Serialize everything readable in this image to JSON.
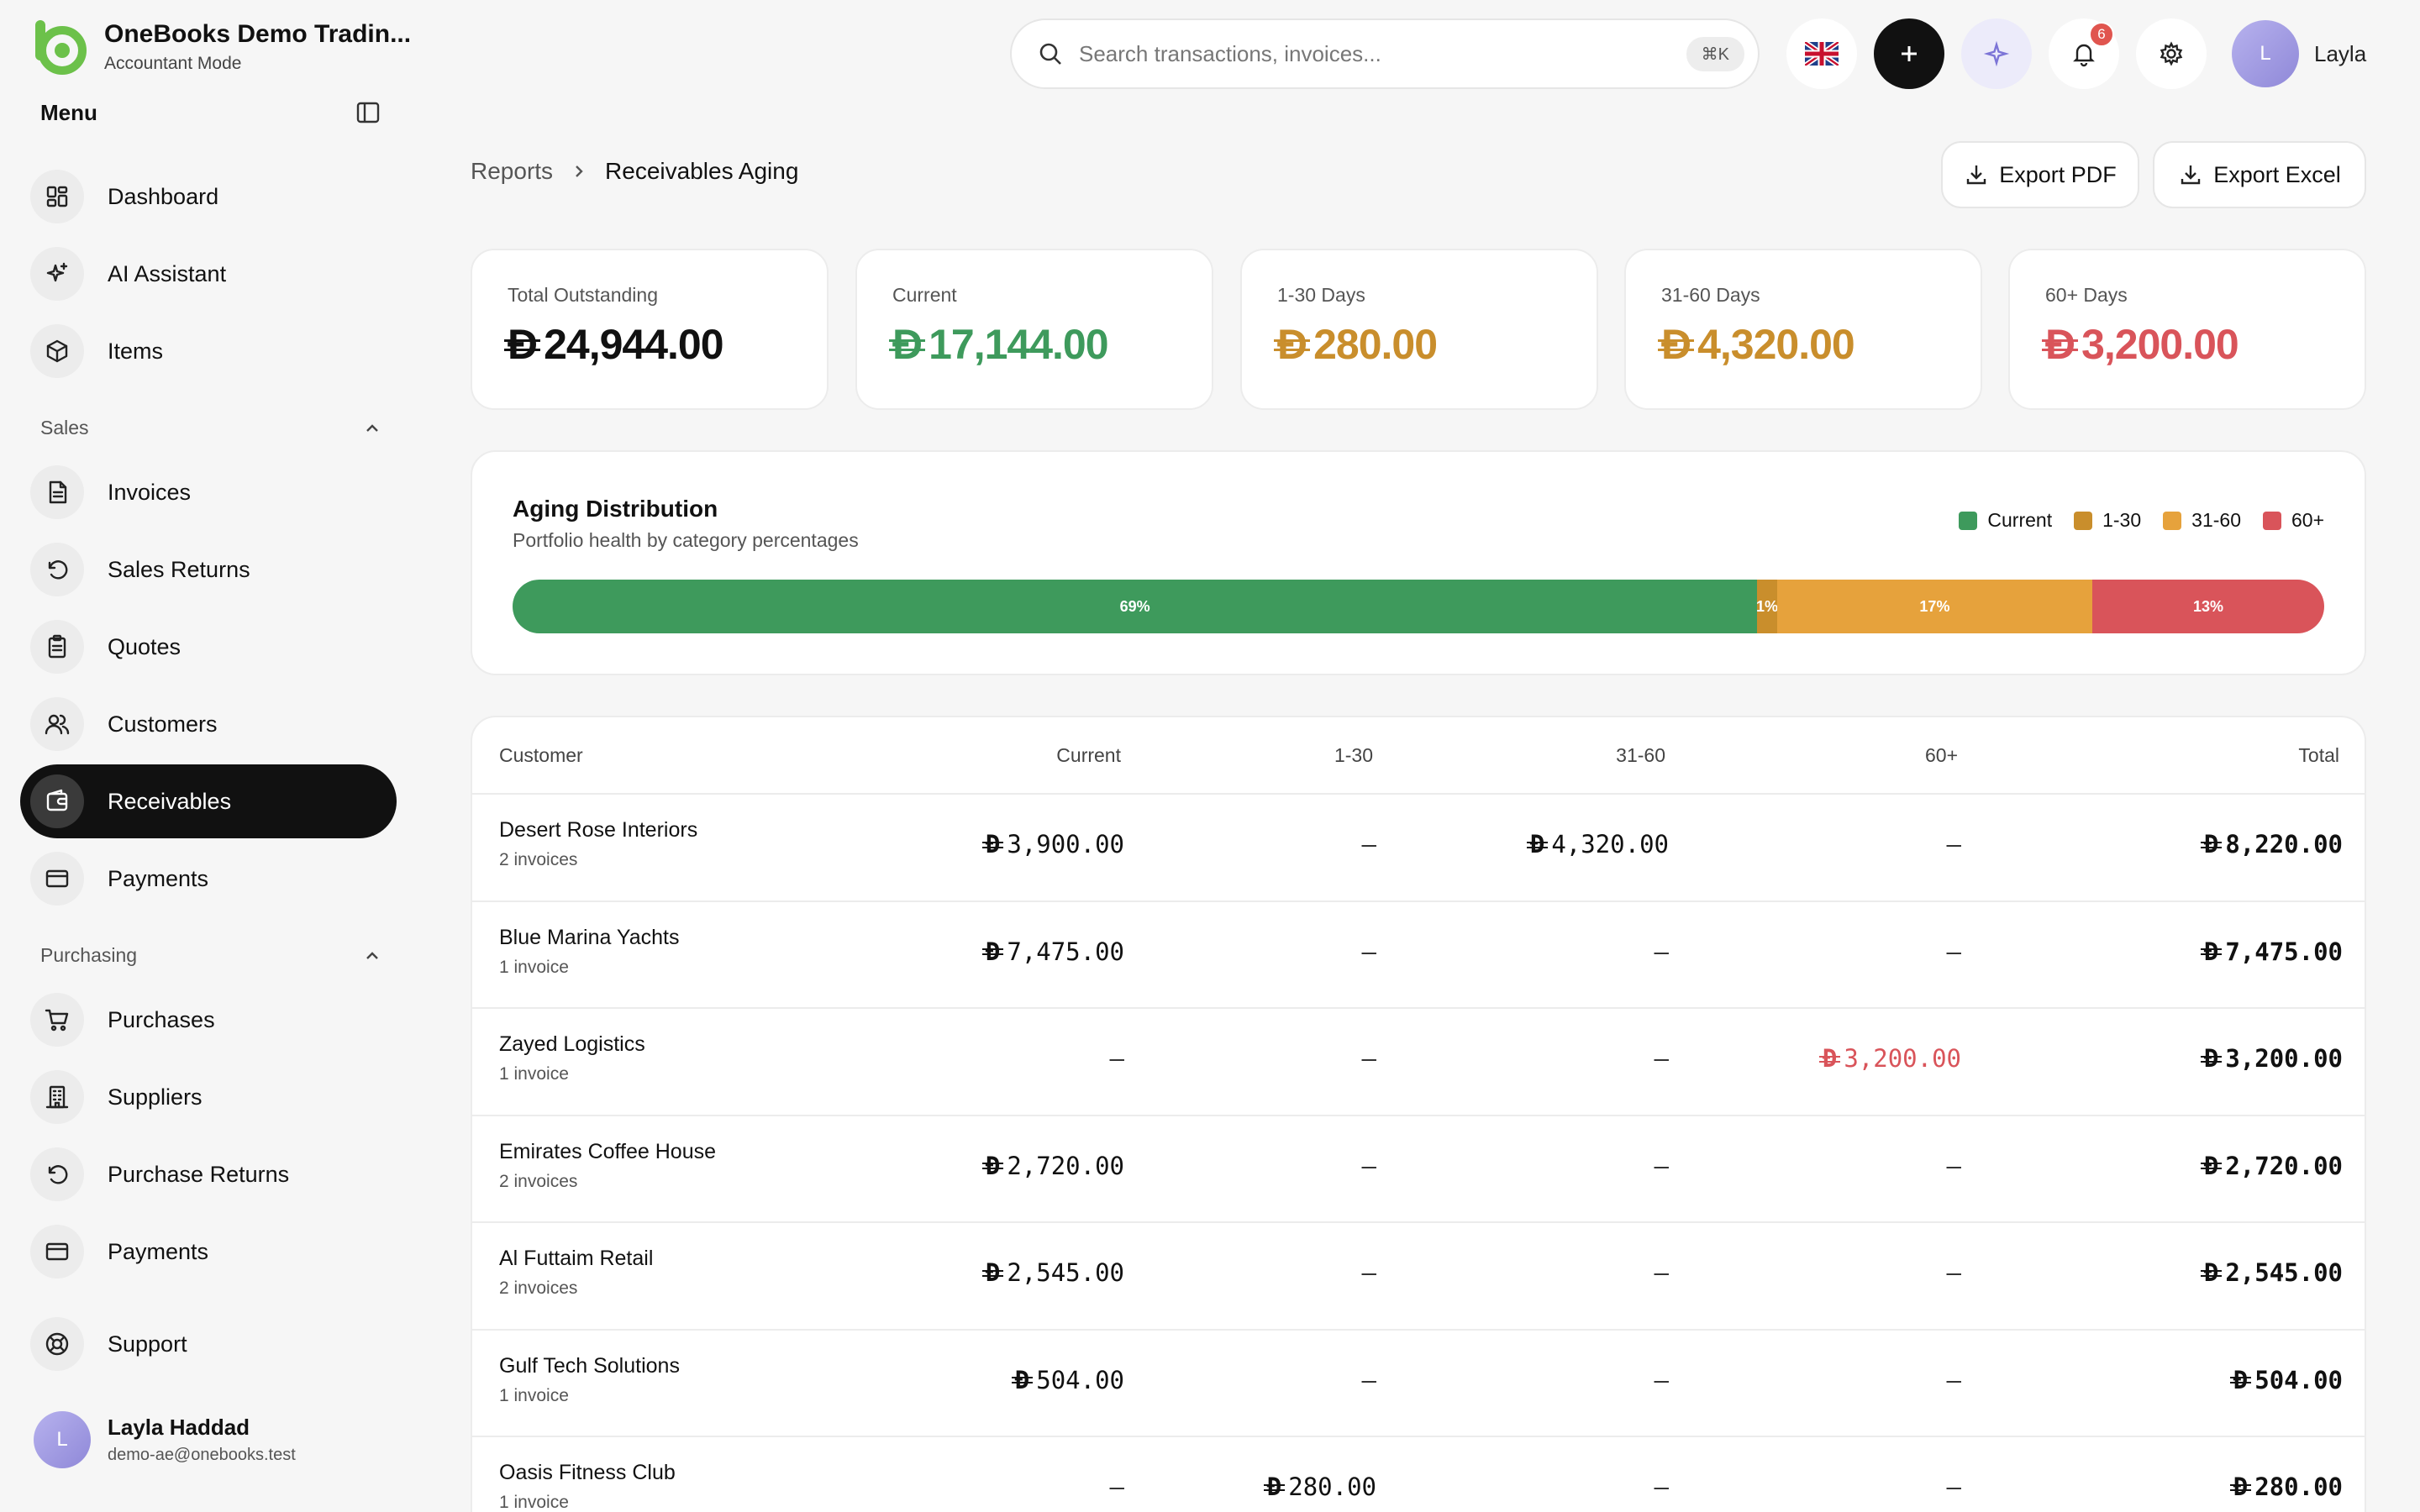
{
  "brand": {
    "name": "OneBooks Demo Tradin...",
    "mode": "Accountant Mode"
  },
  "menu_title": "Menu",
  "nav_top": [
    {
      "label": "Dashboard",
      "icon": "dashboard-icon"
    },
    {
      "label": "AI Assistant",
      "icon": "sparkle-icon"
    },
    {
      "label": "Items",
      "icon": "box-icon"
    }
  ],
  "sections": {
    "sales": "Sales",
    "purchasing": "Purchasing"
  },
  "nav_sales": [
    {
      "label": "Invoices",
      "icon": "invoice-icon"
    },
    {
      "label": "Sales Returns",
      "icon": "return-icon"
    },
    {
      "label": "Quotes",
      "icon": "clipboard-icon"
    },
    {
      "label": "Customers",
      "icon": "users-icon"
    },
    {
      "label": "Receivables",
      "icon": "wallet-icon",
      "active": true
    },
    {
      "label": "Payments",
      "icon": "card-icon"
    }
  ],
  "nav_purchasing": [
    {
      "label": "Purchases",
      "icon": "cart-icon"
    },
    {
      "label": "Suppliers",
      "icon": "building-icon"
    },
    {
      "label": "Purchase Returns",
      "icon": "return-icon"
    },
    {
      "label": "Payments",
      "icon": "card-icon"
    }
  ],
  "support": "Support",
  "user": {
    "initial": "L",
    "name": "Layla Haddad",
    "email": "demo-ae@onebooks.test",
    "short_name": "Layla"
  },
  "search": {
    "placeholder": "Search transactions, invoices...",
    "shortcut": "⌘K"
  },
  "notifications_count": "6",
  "breadcrumb": {
    "parent": "Reports",
    "current": "Receivables Aging"
  },
  "export": {
    "pdf": "Export PDF",
    "excel": "Export Excel"
  },
  "currency_symbol": "Đ",
  "summary": [
    {
      "label": "Total Outstanding",
      "value": "24,944.00",
      "color": "#111111"
    },
    {
      "label": "Current",
      "value": "17,144.00",
      "color": "#3e9a5c"
    },
    {
      "label": "1-30 Days",
      "value": "280.00",
      "color": "#c98e2c"
    },
    {
      "label": "31-60 Days",
      "value": "4,320.00",
      "color": "#c98e2c"
    },
    {
      "label": "60+ Days",
      "value": "3,200.00",
      "color": "#d9545a"
    }
  ],
  "distribution": {
    "title": "Aging Distribution",
    "subtitle": "Portfolio health by category percentages",
    "legend": [
      {
        "label": "Current",
        "color": "#3e9a5c"
      },
      {
        "label": "1-30",
        "color": "#c98e2c"
      },
      {
        "label": "31-60",
        "color": "#e6a23c"
      },
      {
        "label": "60+",
        "color": "#d9545a"
      }
    ],
    "segments": [
      {
        "label": "69%",
        "percent": 68.7,
        "color": "#3e9a5c"
      },
      {
        "label": "1%",
        "percent": 1.1,
        "color": "#c98e2c"
      },
      {
        "label": "17%",
        "percent": 17.4,
        "color": "#e6a23c"
      },
      {
        "label": "13%",
        "percent": 12.8,
        "color": "#d9545a"
      }
    ]
  },
  "table": {
    "headers": [
      "Customer",
      "Current",
      "1-30",
      "31-60",
      "60+",
      "Total"
    ],
    "rows": [
      {
        "name": "Desert Rose Interiors",
        "sub": "2 invoices",
        "current": "3,900.00",
        "d1_30": "",
        "d31_60": "4,320.00",
        "d60": "",
        "total": "8,220.00"
      },
      {
        "name": "Blue Marina Yachts",
        "sub": "1 invoice",
        "current": "7,475.00",
        "d1_30": "",
        "d31_60": "",
        "d60": "",
        "total": "7,475.00"
      },
      {
        "name": "Zayed Logistics",
        "sub": "1 invoice",
        "current": "",
        "d1_30": "",
        "d31_60": "",
        "d60": "3,200.00",
        "total": "3,200.00"
      },
      {
        "name": "Emirates Coffee House",
        "sub": "2 invoices",
        "current": "2,720.00",
        "d1_30": "",
        "d31_60": "",
        "d60": "",
        "total": "2,720.00"
      },
      {
        "name": "Al Futtaim Retail",
        "sub": "2 invoices",
        "current": "2,545.00",
        "d1_30": "",
        "d31_60": "",
        "d60": "",
        "total": "2,545.00"
      },
      {
        "name": "Gulf Tech Solutions",
        "sub": "1 invoice",
        "current": "504.00",
        "d1_30": "",
        "d31_60": "",
        "d60": "",
        "total": "504.00"
      },
      {
        "name": "Oasis Fitness Club",
        "sub": "1 invoice",
        "current": "",
        "d1_30": "280.00",
        "d31_60": "",
        "d60": "",
        "total": "280.00"
      }
    ],
    "empty_cell": "–",
    "overdue_color": "#d9545a"
  }
}
